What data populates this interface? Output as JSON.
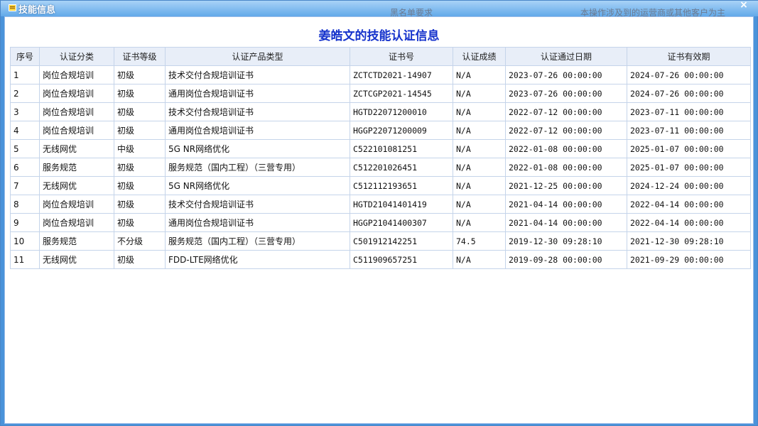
{
  "window": {
    "title": "技能信息",
    "close_symbol": "×"
  },
  "background": {
    "text1": "黑名单要求",
    "text2": "本操作涉及到的运营商或其他客户为主"
  },
  "heading": "姜皓文的技能认证信息",
  "table": {
    "columns": [
      "序号",
      "认证分类",
      "证书等级",
      "认证产品类型",
      "证书号",
      "认证成绩",
      "认证通过日期",
      "证书有效期"
    ],
    "rows": [
      [
        "1",
        "岗位合规培训",
        "初级",
        "技术交付合规培训证书",
        "ZCTCTD2021-14907",
        "N/A",
        "2023-07-26 00:00:00",
        "2024-07-26 00:00:00"
      ],
      [
        "2",
        "岗位合规培训",
        "初级",
        "通用岗位合规培训证书",
        "ZCTCGP2021-14545",
        "N/A",
        "2023-07-26 00:00:00",
        "2024-07-26 00:00:00"
      ],
      [
        "3",
        "岗位合规培训",
        "初级",
        "技术交付合规培训证书",
        "HGTD22071200010",
        "N/A",
        "2022-07-12 00:00:00",
        "2023-07-11 00:00:00"
      ],
      [
        "4",
        "岗位合规培训",
        "初级",
        "通用岗位合规培训证书",
        "HGGP22071200009",
        "N/A",
        "2022-07-12 00:00:00",
        "2023-07-11 00:00:00"
      ],
      [
        "5",
        "无线网优",
        "中级",
        "5G NR网络优化",
        "C522101081251",
        "N/A",
        "2022-01-08 00:00:00",
        "2025-01-07 00:00:00"
      ],
      [
        "6",
        "服务规范",
        "初级",
        "服务规范（国内工程）（三营专用）",
        "C512201026451",
        "N/A",
        "2022-01-08 00:00:00",
        "2025-01-07 00:00:00"
      ],
      [
        "7",
        "无线网优",
        "初级",
        "5G NR网络优化",
        "C512112193651",
        "N/A",
        "2021-12-25 00:00:00",
        "2024-12-24 00:00:00"
      ],
      [
        "8",
        "岗位合规培训",
        "初级",
        "技术交付合规培训证书",
        "HGTD21041401419",
        "N/A",
        "2021-04-14 00:00:00",
        "2022-04-14 00:00:00"
      ],
      [
        "9",
        "岗位合规培训",
        "初级",
        "通用岗位合规培训证书",
        "HGGP21041400307",
        "N/A",
        "2021-04-14 00:00:00",
        "2022-04-14 00:00:00"
      ],
      [
        "10",
        "服务规范",
        "不分级",
        "服务规范（国内工程）（三营专用）",
        "C501912142251",
        "74.5",
        "2019-12-30 09:28:10",
        "2021-12-30 09:28:10"
      ],
      [
        "11",
        "无线网优",
        "初级",
        "FDD-LTE网络优化",
        "C511909657251",
        "N/A",
        "2019-09-28 00:00:00",
        "2021-09-29 00:00:00"
      ]
    ]
  },
  "colors": {
    "heading": "#1633cc",
    "titlebar": "#62a9e9",
    "header_bg": "#e8eef8",
    "grid": "#c5d4ea"
  }
}
